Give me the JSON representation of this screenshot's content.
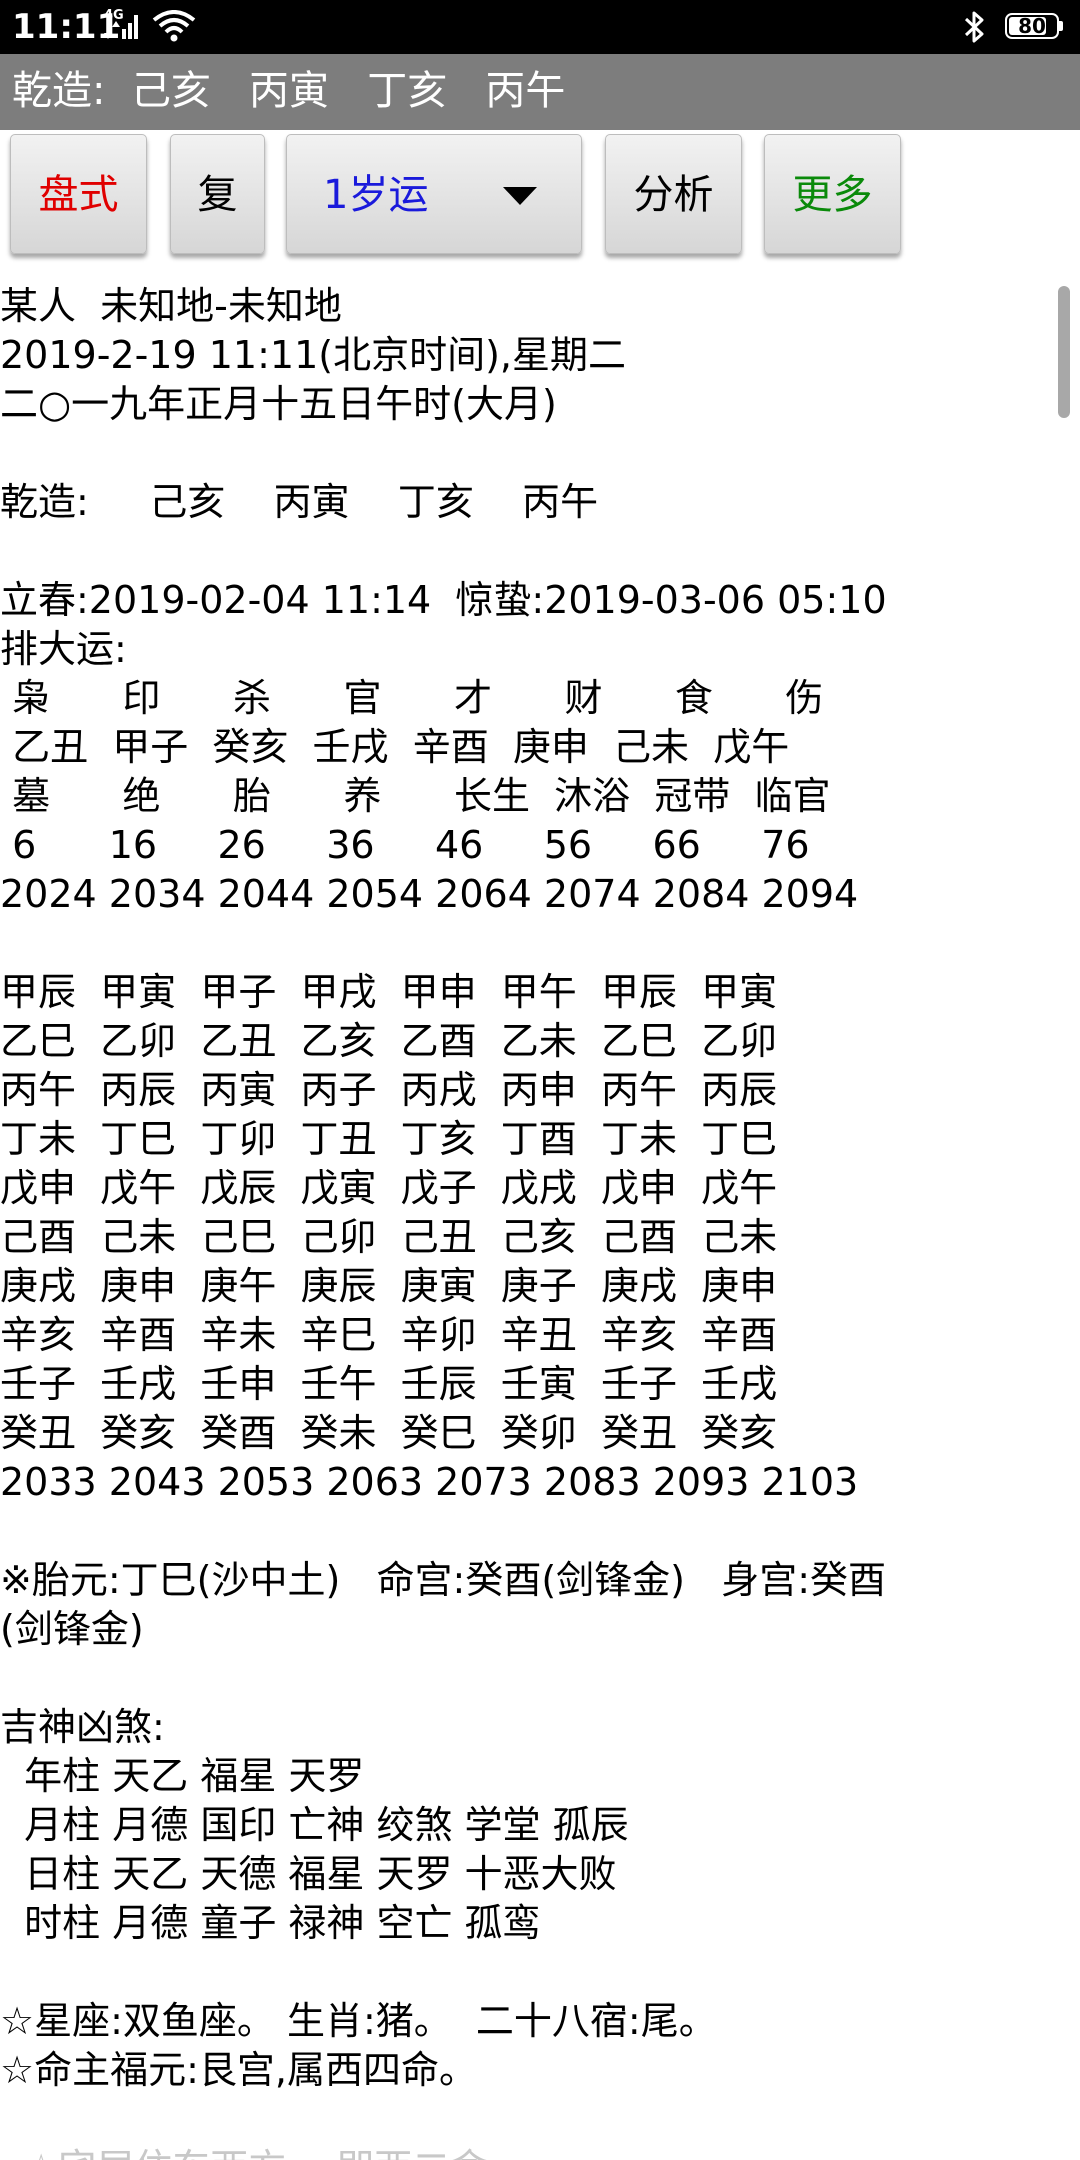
{
  "status_bar": {
    "time": "11:11",
    "network": "4G",
    "battery": "80",
    "battery_level": 0.8
  },
  "title": "乾造:  己亥   丙寅   丁亥   丙午",
  "toolbar": {
    "panshi": "盘式",
    "fu": "复",
    "dayun": "1岁运",
    "fenxi": "分析",
    "gengduo": "更多"
  },
  "content": {
    "lines": [
      "某人  未知地-未知地",
      "2019-2-19 11:11(北京时间),星期二",
      "二○一九年正月十五日午时(大月)",
      "",
      "乾造:     己亥    丙寅    丁亥    丙午",
      "",
      "立春:2019-02-04 11:14  惊蛰:2019-03-06 05:10",
      "排大运:",
      " 枭      印      杀      官      才      财      食      伤",
      " 乙丑  甲子  癸亥  壬戌  辛酉  庚申  己未  戊午",
      " 墓      绝      胎      养      长生  沐浴  冠带  临官",
      " 6      16     26     36     46     56     66     76",
      "2024 2034 2044 2054 2064 2074 2084 2094",
      "",
      "甲辰  甲寅  甲子  甲戌  甲申  甲午  甲辰  甲寅",
      "乙巳  乙卯  乙丑  乙亥  乙酉  乙未  乙巳  乙卯",
      "丙午  丙辰  丙寅  丙子  丙戌  丙申  丙午  丙辰",
      "丁未  丁巳  丁卯  丁丑  丁亥  丁酉  丁未  丁巳",
      "戊申  戊午  戊辰  戊寅  戊子  戊戌  戊申  戊午",
      "己酉  己未  己巳  己卯  己丑  己亥  己酉  己未",
      "庚戌  庚申  庚午  庚辰  庚寅  庚子  庚戌  庚申",
      "辛亥  辛酉  辛未  辛巳  辛卯  辛丑  辛亥  辛酉",
      "壬子  壬戌  壬申  壬午  壬辰  壬寅  壬子  壬戌",
      "癸丑  癸亥  癸酉  癸未  癸巳  癸卯  癸丑  癸亥",
      "2033 2043 2053 2063 2073 2083 2093 2103",
      "",
      "※胎元:丁巳(沙中土)   命宫:癸酉(剑锋金)   身宫:癸酉",
      "(剑锋金)",
      "",
      "吉神凶煞:",
      "  年柱 天乙 福星 天罗",
      "  月柱 月德 国印 亡神 绞煞 学堂 孤辰",
      "  日柱 天乙 天德 福星 天罗 十恶大败",
      "  时柱 月德 童子 禄神 空亡 孤鸾",
      "",
      "☆星座:双鱼座。 生肖:猪。  二十八宿:尾。",
      "☆命主福元:艮宫,属西四命。",
      ""
    ],
    "faded_line": "  ☆宅居住东西方。 即西二命"
  }
}
